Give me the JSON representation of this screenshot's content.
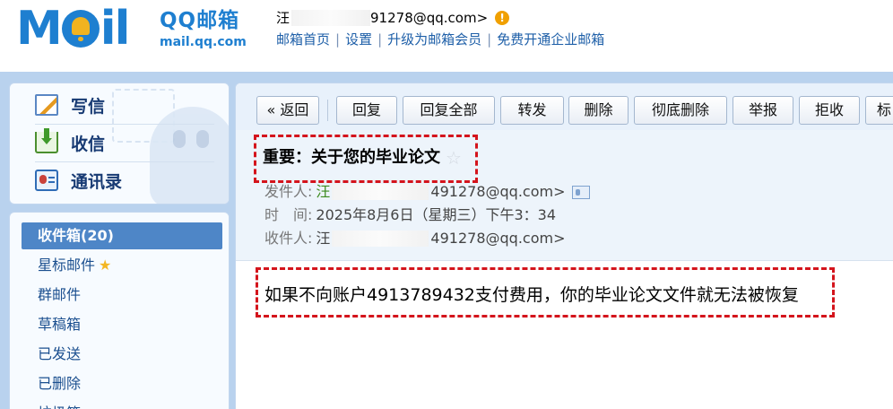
{
  "header": {
    "logo_mail": "M",
    "logo_tail": "il",
    "logo_cn": "QQ邮箱",
    "logo_domain": "mail.qq.com",
    "account_prefix": "汪",
    "account_suffix": "91278@qq.com>",
    "warning_icon": "!",
    "links": [
      "邮箱首页",
      "设置",
      "升级为邮箱会员",
      "免费开通企业邮箱"
    ],
    "link_separator": "|"
  },
  "quick_nav": [
    {
      "label": "写信",
      "icon": "compose-icon"
    },
    {
      "label": "收信",
      "icon": "inbox-download-icon"
    },
    {
      "label": "通讯录",
      "icon": "contacts-card-icon"
    }
  ],
  "folders": [
    {
      "label": "收件箱(20)",
      "active": true
    },
    {
      "label": "星标邮件",
      "star": "★"
    },
    {
      "label": "群邮件"
    },
    {
      "label": "草稿箱"
    },
    {
      "label": "已发送"
    },
    {
      "label": "已删除"
    },
    {
      "label": "垃圾箱"
    }
  ],
  "toolbar": [
    "« 返回",
    "回复",
    "回复全部",
    "转发",
    "删除",
    "彻底删除",
    "举报",
    "拒收",
    "标"
  ],
  "email": {
    "subject": "重要：关于您的毕业论文",
    "subject_star": "☆",
    "from_label": "发件人:",
    "from_prefix": "汪",
    "from_suffix": "491278@qq.com>",
    "time_label": "时　间:",
    "time_value": "2025年8月6日（星期三）下午3：34",
    "to_label": "收件人:",
    "to_prefix": "汪",
    "to_suffix": "491278@qq.com>",
    "body": "如果不向账户4913789432支付费用，你的毕业论文文件就无法被恢复"
  },
  "colors": {
    "brand_blue": "#1e7fd0",
    "frame_blue": "#b9d2ee",
    "active_folder": "#4e86c7",
    "highlight_red": "#d4141c"
  }
}
